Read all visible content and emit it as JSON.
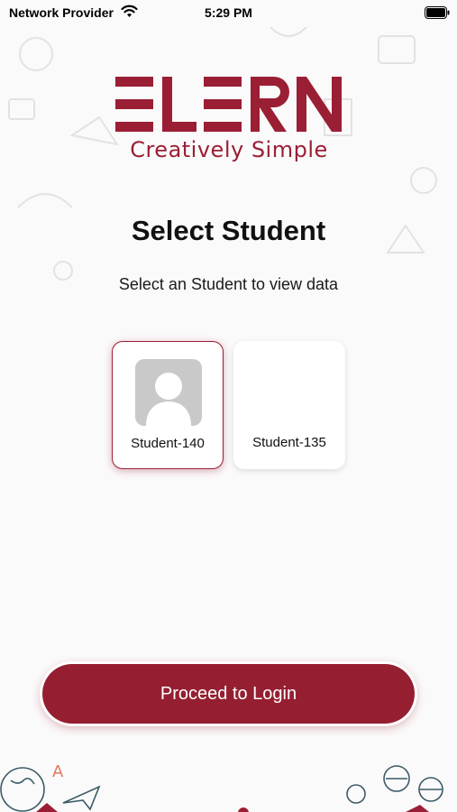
{
  "status_bar": {
    "carrier": "Network Provider",
    "time": "5:29 PM",
    "wifi_icon": "wifi-icon",
    "battery_icon": "battery-icon"
  },
  "brand": {
    "wordmark": "ELERN",
    "tagline": "Creatively Simple",
    "color": "#9a1f35"
  },
  "page": {
    "title": "Select Student",
    "subtitle": "Select an Student to view data"
  },
  "students": [
    {
      "name": "Student-140",
      "selected": true,
      "avatar": "person-placeholder-icon"
    },
    {
      "name": "Student-135",
      "selected": false,
      "avatar": ""
    }
  ],
  "actions": {
    "proceed_label": "Proceed to Login",
    "button_color": "#951f31"
  }
}
